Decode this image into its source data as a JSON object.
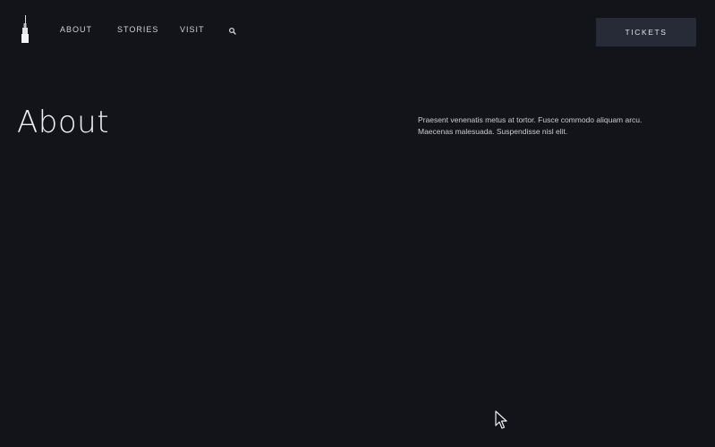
{
  "header": {
    "nav": {
      "about": "ABOUT",
      "stories": "STORIES",
      "visit": "VISIT",
      "search_icon": "search-icon"
    },
    "tickets_label": "TICKETS"
  },
  "main": {
    "title": "About",
    "intro": "Praesent venenatis metus at tortor. Fusce commodo aliquam arcu. Maecenas malesuada. Suspendisse nisl elit."
  },
  "colors": {
    "background": "#121419",
    "button_bg": "#262b37",
    "text": "#e8e9ea"
  }
}
